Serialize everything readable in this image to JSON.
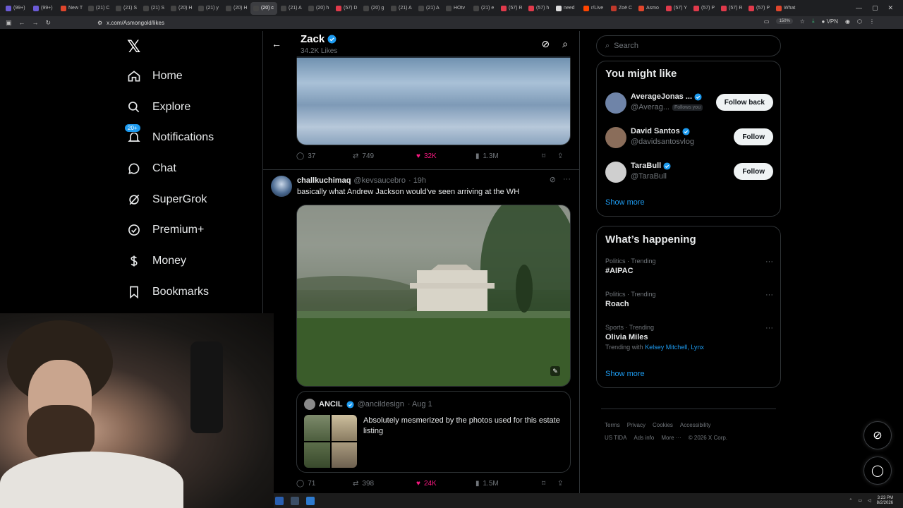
{
  "browser": {
    "tabs": [
      "(99+)",
      "(99+)",
      "New T",
      "(21) C",
      "(21) S",
      "(21) S",
      "(20) H",
      "(21) y",
      "(20) H",
      "(20) c",
      "(21) A",
      "(20) h",
      "(57) D",
      "(20) g",
      "(21) A",
      "(21) A",
      "HOtv",
      "(21) e",
      "(57) R",
      "(57) h",
      "need",
      "r/Live",
      "Zoë C",
      "Asmo",
      "(57) Y",
      "(57) P",
      "(57) R",
      "(57) P",
      "What"
    ],
    "active_tab_index": 9,
    "url": "x.com/Asmongold/likes",
    "zoom": "150%",
    "vpn": "VPN"
  },
  "nav": {
    "items": [
      {
        "label": "Home",
        "icon": "home-icon"
      },
      {
        "label": "Explore",
        "icon": "search-icon"
      },
      {
        "label": "Notifications",
        "icon": "bell-icon",
        "badge": "20+"
      },
      {
        "label": "Chat",
        "icon": "chat-icon"
      },
      {
        "label": "SuperGrok",
        "icon": "grok-icon"
      },
      {
        "label": "Premium+",
        "icon": "verified-icon"
      },
      {
        "label": "Money",
        "icon": "dollar-icon"
      },
      {
        "label": "Bookmarks",
        "icon": "bookmark-icon"
      }
    ]
  },
  "profile": {
    "name": "Zack",
    "sub": "34.2K Likes"
  },
  "tweet1": {
    "replies": "37",
    "reposts": "749",
    "likes": "32K",
    "views": "1.3M"
  },
  "tweet2": {
    "name": "challkuchimaq",
    "handle": "@kevsaucebro",
    "time": "· 19h",
    "text": "basically what Andrew Jackson would've seen arriving at the WH",
    "quote": {
      "name": "ANCIL",
      "handle": "@ancildesign",
      "time": "· Aug 1",
      "text": "Absolutely mesmerized by the photos used for this estate listing"
    },
    "replies": "71",
    "reposts": "398",
    "likes": "24K",
    "views": "1.5M"
  },
  "search": {
    "placeholder": "Search"
  },
  "you_might_like": {
    "title": "You might like",
    "people": [
      {
        "name": "AverageJonas ...",
        "handle": "@Averag...",
        "follows_you": "Follows you",
        "button": "Follow back",
        "color": "#6f84a8"
      },
      {
        "name": "David Santos",
        "handle": "@davidsantosvlog",
        "follows_you": "",
        "button": "Follow",
        "color": "#8a6d5a"
      },
      {
        "name": "TaraBull",
        "handle": "@TaraBull",
        "follows_you": "",
        "button": "Follow",
        "color": "#cfcfcf"
      }
    ],
    "show_more": "Show more"
  },
  "whats_happening": {
    "title": "What’s happening",
    "trends": [
      {
        "category": "Politics · Trending",
        "name": "#AIPAC",
        "with_label": "",
        "with": ""
      },
      {
        "category": "Politics · Trending",
        "name": "Roach",
        "with_label": "",
        "with": ""
      },
      {
        "category": "Sports · Trending",
        "name": "Olivia Miles",
        "with_label": "Trending with",
        "with": "Kelsey Mitchell, Lynx"
      }
    ],
    "show_more": "Show more"
  },
  "footer": {
    "links": [
      "Terms",
      "Privacy",
      "Cookies",
      "Accessibility",
      "US TIDA",
      "Ads info",
      "More ···",
      "© 2026 X Corp."
    ]
  },
  "taskbar": {
    "time": "3:23 PM",
    "date": "8/2/2026"
  },
  "colors": {
    "accent": "#1d9bf0",
    "like": "#f91880",
    "background": "#000000"
  }
}
